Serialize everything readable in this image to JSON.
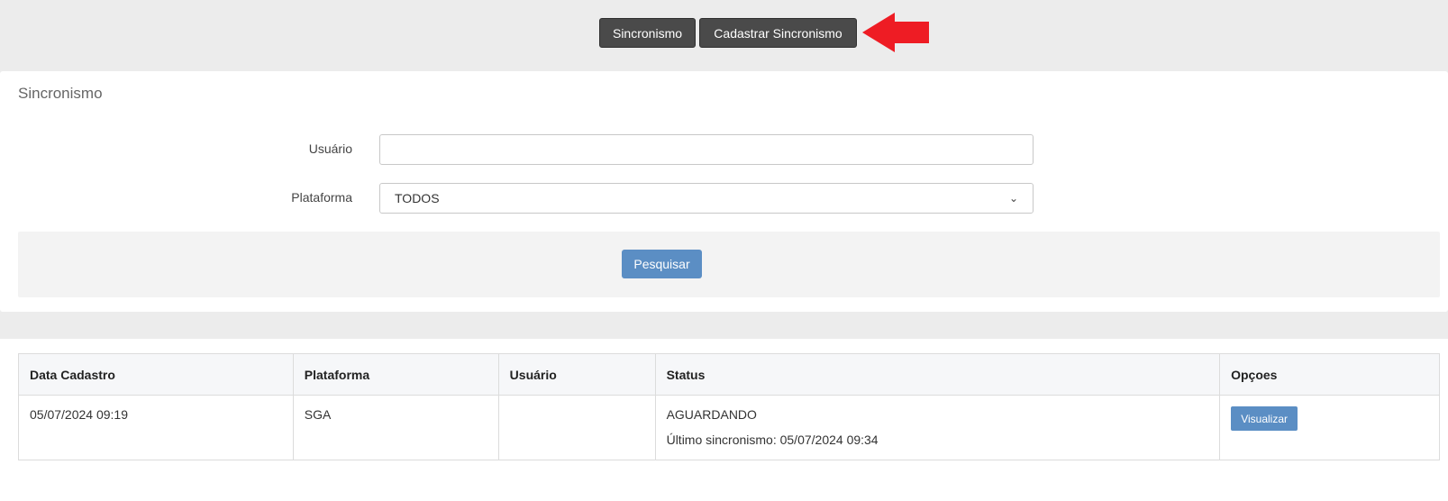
{
  "toolbar": {
    "sync_label": "Sincronismo",
    "register_label": "Cadastrar Sincronismo",
    "arrow_color": "#ee1c24"
  },
  "search_panel": {
    "title": "Sincronismo",
    "user_label": "Usuário",
    "user_value": "",
    "platform_label": "Plataforma",
    "platform_selected": "TODOS",
    "search_label": "Pesquisar"
  },
  "table": {
    "columns": [
      "Data Cadastro",
      "Plataforma",
      "Usuário",
      "Status",
      "Opçoes"
    ],
    "rows": [
      {
        "date": "05/07/2024 09:19",
        "platform": "SGA",
        "user": "",
        "status": "AGUARDANDO",
        "last_sync": "Último sincronismo: 05/07/2024 09:34",
        "action_label": "Visualizar"
      }
    ]
  },
  "colors": {
    "dark_button": "#4a4a4a",
    "primary_button": "#5b8ec4",
    "background": "#ececec"
  }
}
